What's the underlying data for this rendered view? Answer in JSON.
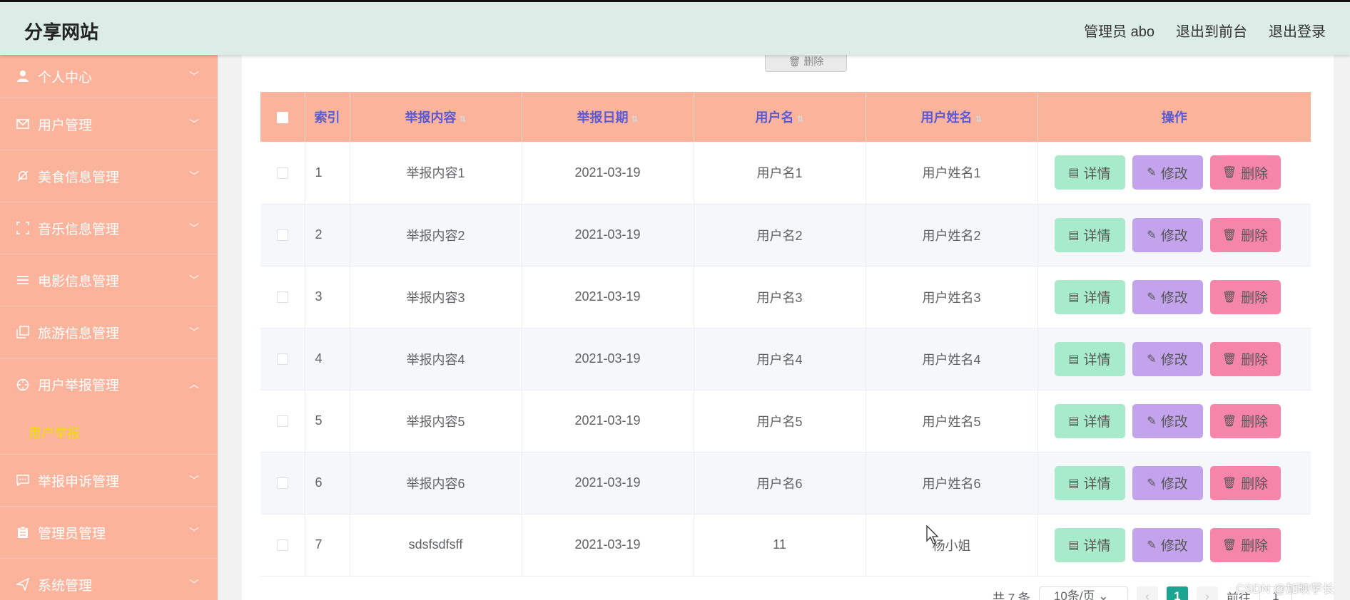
{
  "header": {
    "brand": "分享网站",
    "admin": "管理员 abo",
    "to_front": "退出到前台",
    "logout": "退出登录"
  },
  "sidebar": {
    "items": [
      {
        "label": "个人中心",
        "icon": "user-icon"
      },
      {
        "label": "用户管理",
        "icon": "mail-icon"
      },
      {
        "label": "美食信息管理",
        "icon": "bell-off-icon"
      },
      {
        "label": "音乐信息管理",
        "icon": "fullscreen-icon"
      },
      {
        "label": "电影信息管理",
        "icon": "list-icon"
      },
      {
        "label": "旅游信息管理",
        "icon": "copy-icon"
      },
      {
        "label": "用户举报管理",
        "icon": "target-icon"
      },
      {
        "label": "举报申诉管理",
        "icon": "chat-icon"
      },
      {
        "label": "管理员管理",
        "icon": "clipboard-icon"
      },
      {
        "label": "系统管理",
        "icon": "send-icon"
      }
    ],
    "sub_item": "用户举报"
  },
  "toolbar": {
    "delete_label": "删除"
  },
  "table": {
    "headers": [
      "索引",
      "举报内容",
      "举报日期",
      "用户名",
      "用户姓名",
      "操作"
    ],
    "rows": [
      {
        "index": "1",
        "content": "举报内容1",
        "date": "2021-03-19",
        "username": "用户名1",
        "name": "用户姓名1"
      },
      {
        "index": "2",
        "content": "举报内容2",
        "date": "2021-03-19",
        "username": "用户名2",
        "name": "用户姓名2"
      },
      {
        "index": "3",
        "content": "举报内容3",
        "date": "2021-03-19",
        "username": "用户名3",
        "name": "用户姓名3"
      },
      {
        "index": "4",
        "content": "举报内容4",
        "date": "2021-03-19",
        "username": "用户名4",
        "name": "用户姓名4"
      },
      {
        "index": "5",
        "content": "举报内容5",
        "date": "2021-03-19",
        "username": "用户名5",
        "name": "用户姓名5"
      },
      {
        "index": "6",
        "content": "举报内容6",
        "date": "2021-03-19",
        "username": "用户名6",
        "name": "用户姓名6"
      },
      {
        "index": "7",
        "content": "sdsfsdfsff",
        "date": "2021-03-19",
        "username": "11",
        "name": "杨小姐"
      }
    ],
    "actions": {
      "detail": "详情",
      "edit": "修改",
      "delete": "删除"
    }
  },
  "pagination": {
    "total": "共 7 条",
    "page_size": "10条/页",
    "current": "1",
    "goto_label": "前往",
    "goto_value": "1"
  },
  "watermark": "CSDN @加映学长",
  "colors": {
    "header_bg": "#dcece6",
    "sidebar_bg": "#fbb39c",
    "table_head_bg": "#fbb49c",
    "detail_btn": "#a8ebcb",
    "edit_btn": "#c3a4ec",
    "delete_btn": "#f685aa",
    "active_page": "#19a58f"
  }
}
